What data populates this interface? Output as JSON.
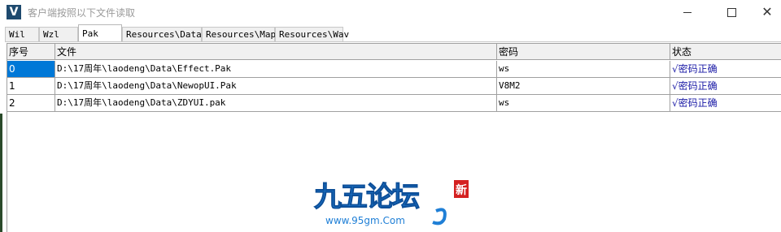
{
  "window": {
    "title": "客户端按照以下文件读取"
  },
  "tabs": [
    {
      "label": "Wil"
    },
    {
      "label": "Wzl"
    },
    {
      "label": "Pak"
    },
    {
      "label": "Resources\\Data"
    },
    {
      "label": "Resources\\Map"
    },
    {
      "label": "Resources\\Wav"
    }
  ],
  "active_tab": "Pak",
  "table": {
    "headers": [
      "序号",
      "文件",
      "密码",
      "状态"
    ],
    "rows": [
      {
        "index": "0",
        "file": "D:\\17周年\\laodeng\\Data\\Effect.Pak",
        "password": "ws",
        "status": "√密码正确"
      },
      {
        "index": "1",
        "file": "D:\\17周年\\laodeng\\Data\\NewopUI.Pak",
        "password": "V8M2",
        "status": "√密码正确"
      },
      {
        "index": "2",
        "file": "D:\\17周年\\laodeng\\Data\\ZDYUI.pak",
        "password": "ws",
        "status": "√密码正确"
      }
    ]
  },
  "watermark": {
    "brand": "九五论坛",
    "url": "www.95gm.Com",
    "badge": "新"
  },
  "colors": {
    "selection": "#0078d7",
    "status_text": "#1a1aa6",
    "logo_blue": "#1f7fd6"
  }
}
